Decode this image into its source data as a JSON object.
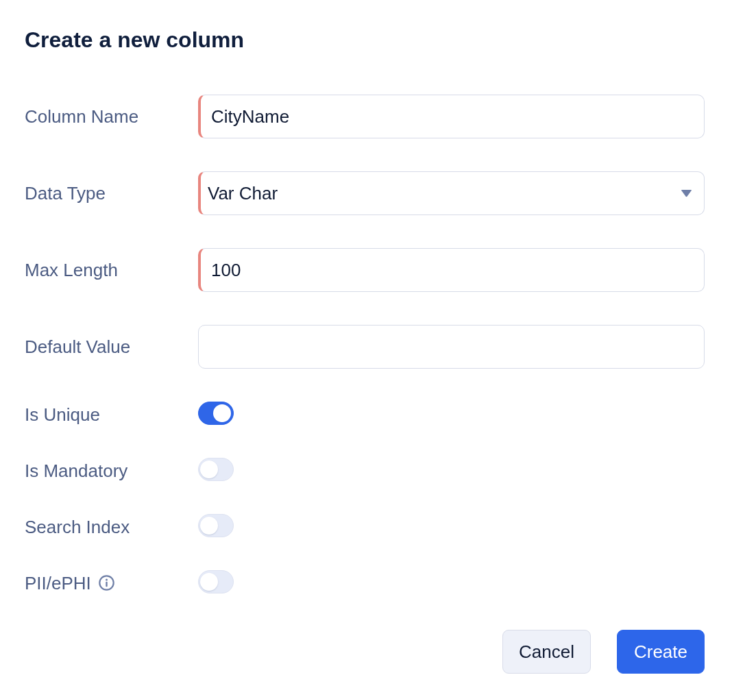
{
  "dialog": {
    "title": "Create a new column"
  },
  "fields": [
    {
      "kind": "text",
      "label": "Column Name",
      "value": "CityName",
      "required": true
    },
    {
      "kind": "select",
      "label": "Data Type",
      "value": "Var Char",
      "required": true
    },
    {
      "kind": "text",
      "label": "Max Length",
      "value": "100",
      "required": true
    },
    {
      "kind": "text",
      "label": "Default Value",
      "required": false
    }
  ],
  "toggles": [
    {
      "label": "Is Unique",
      "on": true,
      "info": false
    },
    {
      "label": "Is Mandatory",
      "on": false,
      "info": false
    },
    {
      "label": "Search Index",
      "on": false,
      "info": false
    },
    {
      "label": "PII/ePHI",
      "on": false,
      "info": true
    }
  ],
  "buttons": [
    {
      "kind": "secondary",
      "label": "Cancel"
    },
    {
      "kind": "primary",
      "label": "Create"
    }
  ]
}
